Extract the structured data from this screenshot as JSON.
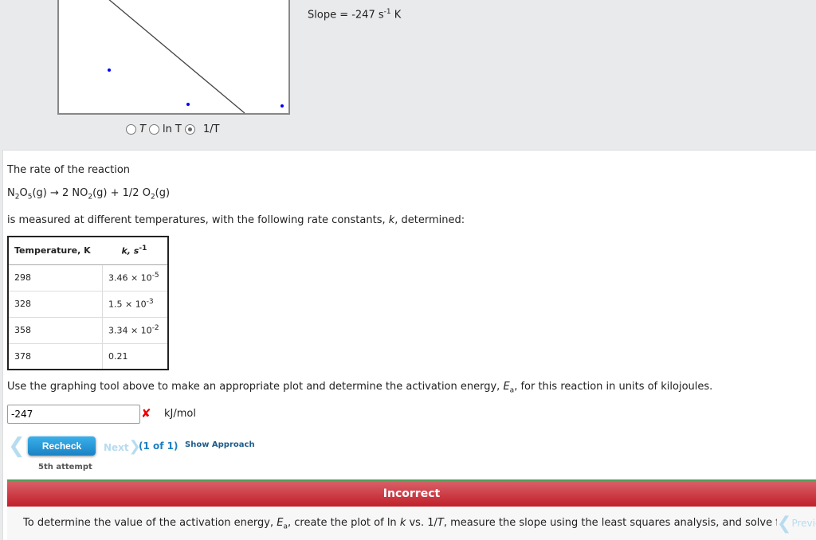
{
  "graph": {
    "slope_label": "Slope = -247 s",
    "slope_exp": "-1",
    "slope_unit": " K",
    "radios": [
      {
        "label": "T",
        "selected": false
      },
      {
        "label": "ln T",
        "selected": false
      },
      {
        "label": "1/T",
        "selected": true
      }
    ],
    "point_color": "#0000ff"
  },
  "question": {
    "intro": "The rate of the reaction",
    "reaction": {
      "r1": "N",
      "r1s": "2",
      "r1b": "O",
      "r1s2": "5",
      "r1c": "(g) → 2 NO",
      "p1s": "2",
      "p1c": "(g) + 1/2 O",
      "p2s": "2",
      "p2c": "(g)"
    },
    "measured": "is measured at different temperatures, with the following rate constants, ",
    "k": "k",
    "measured_end": ", determined:",
    "table": {
      "headers": [
        "Temperature, K",
        "k, s"
      ],
      "header_exp": "-1",
      "rows": [
        {
          "t": "298",
          "k": "3.46 × 10",
          "e": "-5"
        },
        {
          "t": "328",
          "k": "1.5 × 10",
          "e": "-3"
        },
        {
          "t": "358",
          "k": "3.34 × 10",
          "e": "-2"
        },
        {
          "t": "378",
          "k": "0.21",
          "e": ""
        }
      ]
    },
    "instruction_a": "Use the graphing tool above to make an appropriate plot and determine the activation energy, ",
    "ea": "E",
    "ea_sub": "a",
    "instruction_b": ", for this reaction in units of kilojoules."
  },
  "answer": {
    "value": "-247",
    "unit": "kJ/mol",
    "status": "incorrect"
  },
  "nav": {
    "recheck": "Recheck",
    "next": "Next",
    "count": "(1 of 1)",
    "approach": "Show Approach",
    "attempt": "5th attempt",
    "previous": "Previou"
  },
  "feedback": {
    "title": "Incorrect",
    "text_a": "To determine the value of the activation energy, ",
    "ea": "E",
    "ea_sub": "a",
    "text_b": ", create the plot of ln ",
    "k": "k",
    "text_c": " vs. 1/",
    "T": "T",
    "text_d": ", measure the slope using the least squares analysis, and solve fo"
  }
}
